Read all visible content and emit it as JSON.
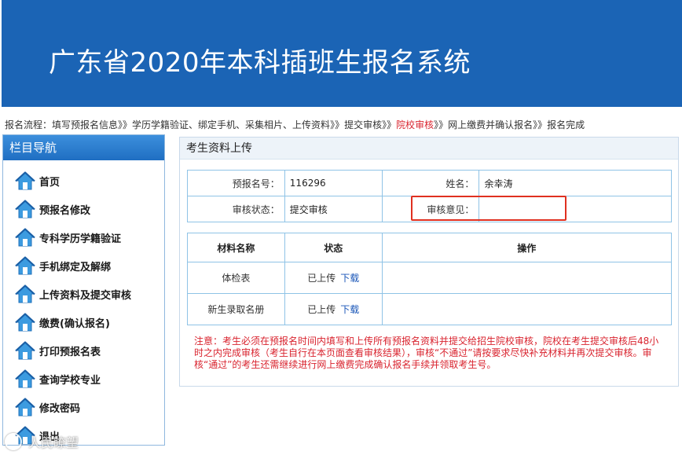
{
  "header": {
    "title": "广东省2020年本科插班生报名系统",
    "bg_color": "#1b64b5"
  },
  "flow": {
    "prefix": "报名流程：",
    "steps": [
      {
        "label": "填写预报名信息",
        "active": false
      },
      {
        "label": "学历学籍验证、绑定手机、采集相片、上传资料",
        "active": false
      },
      {
        "label": "提交审核",
        "active": false
      },
      {
        "label": "院校审核",
        "active": true
      },
      {
        "label": "网上缴费并确认报名",
        "active": false
      },
      {
        "label": "报名完成",
        "active": false
      }
    ],
    "separator": "》》",
    "active_color": "#d9232e"
  },
  "sidebar": {
    "title": "栏目导航",
    "items": [
      {
        "label": "首页",
        "icon": "house-icon"
      },
      {
        "label": "预报名修改",
        "icon": "house-icon"
      },
      {
        "label": "专科学历学籍验证",
        "icon": "house-icon"
      },
      {
        "label": "手机绑定及解绑",
        "icon": "house-icon"
      },
      {
        "label": "上传资料及提交审核",
        "icon": "house-icon"
      },
      {
        "label": "缴费(确认报名)",
        "icon": "house-icon"
      },
      {
        "label": "打印预报名表",
        "icon": "house-icon"
      },
      {
        "label": "查询学校专业",
        "icon": "house-icon"
      },
      {
        "label": "修改密码",
        "icon": "house-icon"
      },
      {
        "label": "退出",
        "icon": "house-icon"
      }
    ]
  },
  "panel": {
    "title": "考生资料上传",
    "info": {
      "reg_no_label": "预报名号：",
      "reg_no": "116296",
      "name_label": "姓名：",
      "name": "余幸涛",
      "status_label": "审核状态：",
      "status": "提交审核",
      "opinion_label": "审核意见：",
      "opinion": ""
    },
    "materials": {
      "headers": [
        "材料名称",
        "状态",
        "操作"
      ],
      "rows": [
        {
          "name": "体检表",
          "status": "已上传",
          "download": "下载"
        },
        {
          "name": "新生录取名册",
          "status": "已上传",
          "download": "下载"
        }
      ]
    },
    "notice": "注意：考生必须在预报名时间内填写和上传所有预报名资料并提交给招生院校审核，院校在考生提交审核后48小时之内完成审核（考生自行在本页面查看审核结果），审核“不通过”请按要求尽快补充材料并再次提交审核。审核“通过”的考生还需继续进行网上缴费完成确认报名手续并领取考生号。"
  },
  "watermark": {
    "text": "人民瞭望"
  }
}
